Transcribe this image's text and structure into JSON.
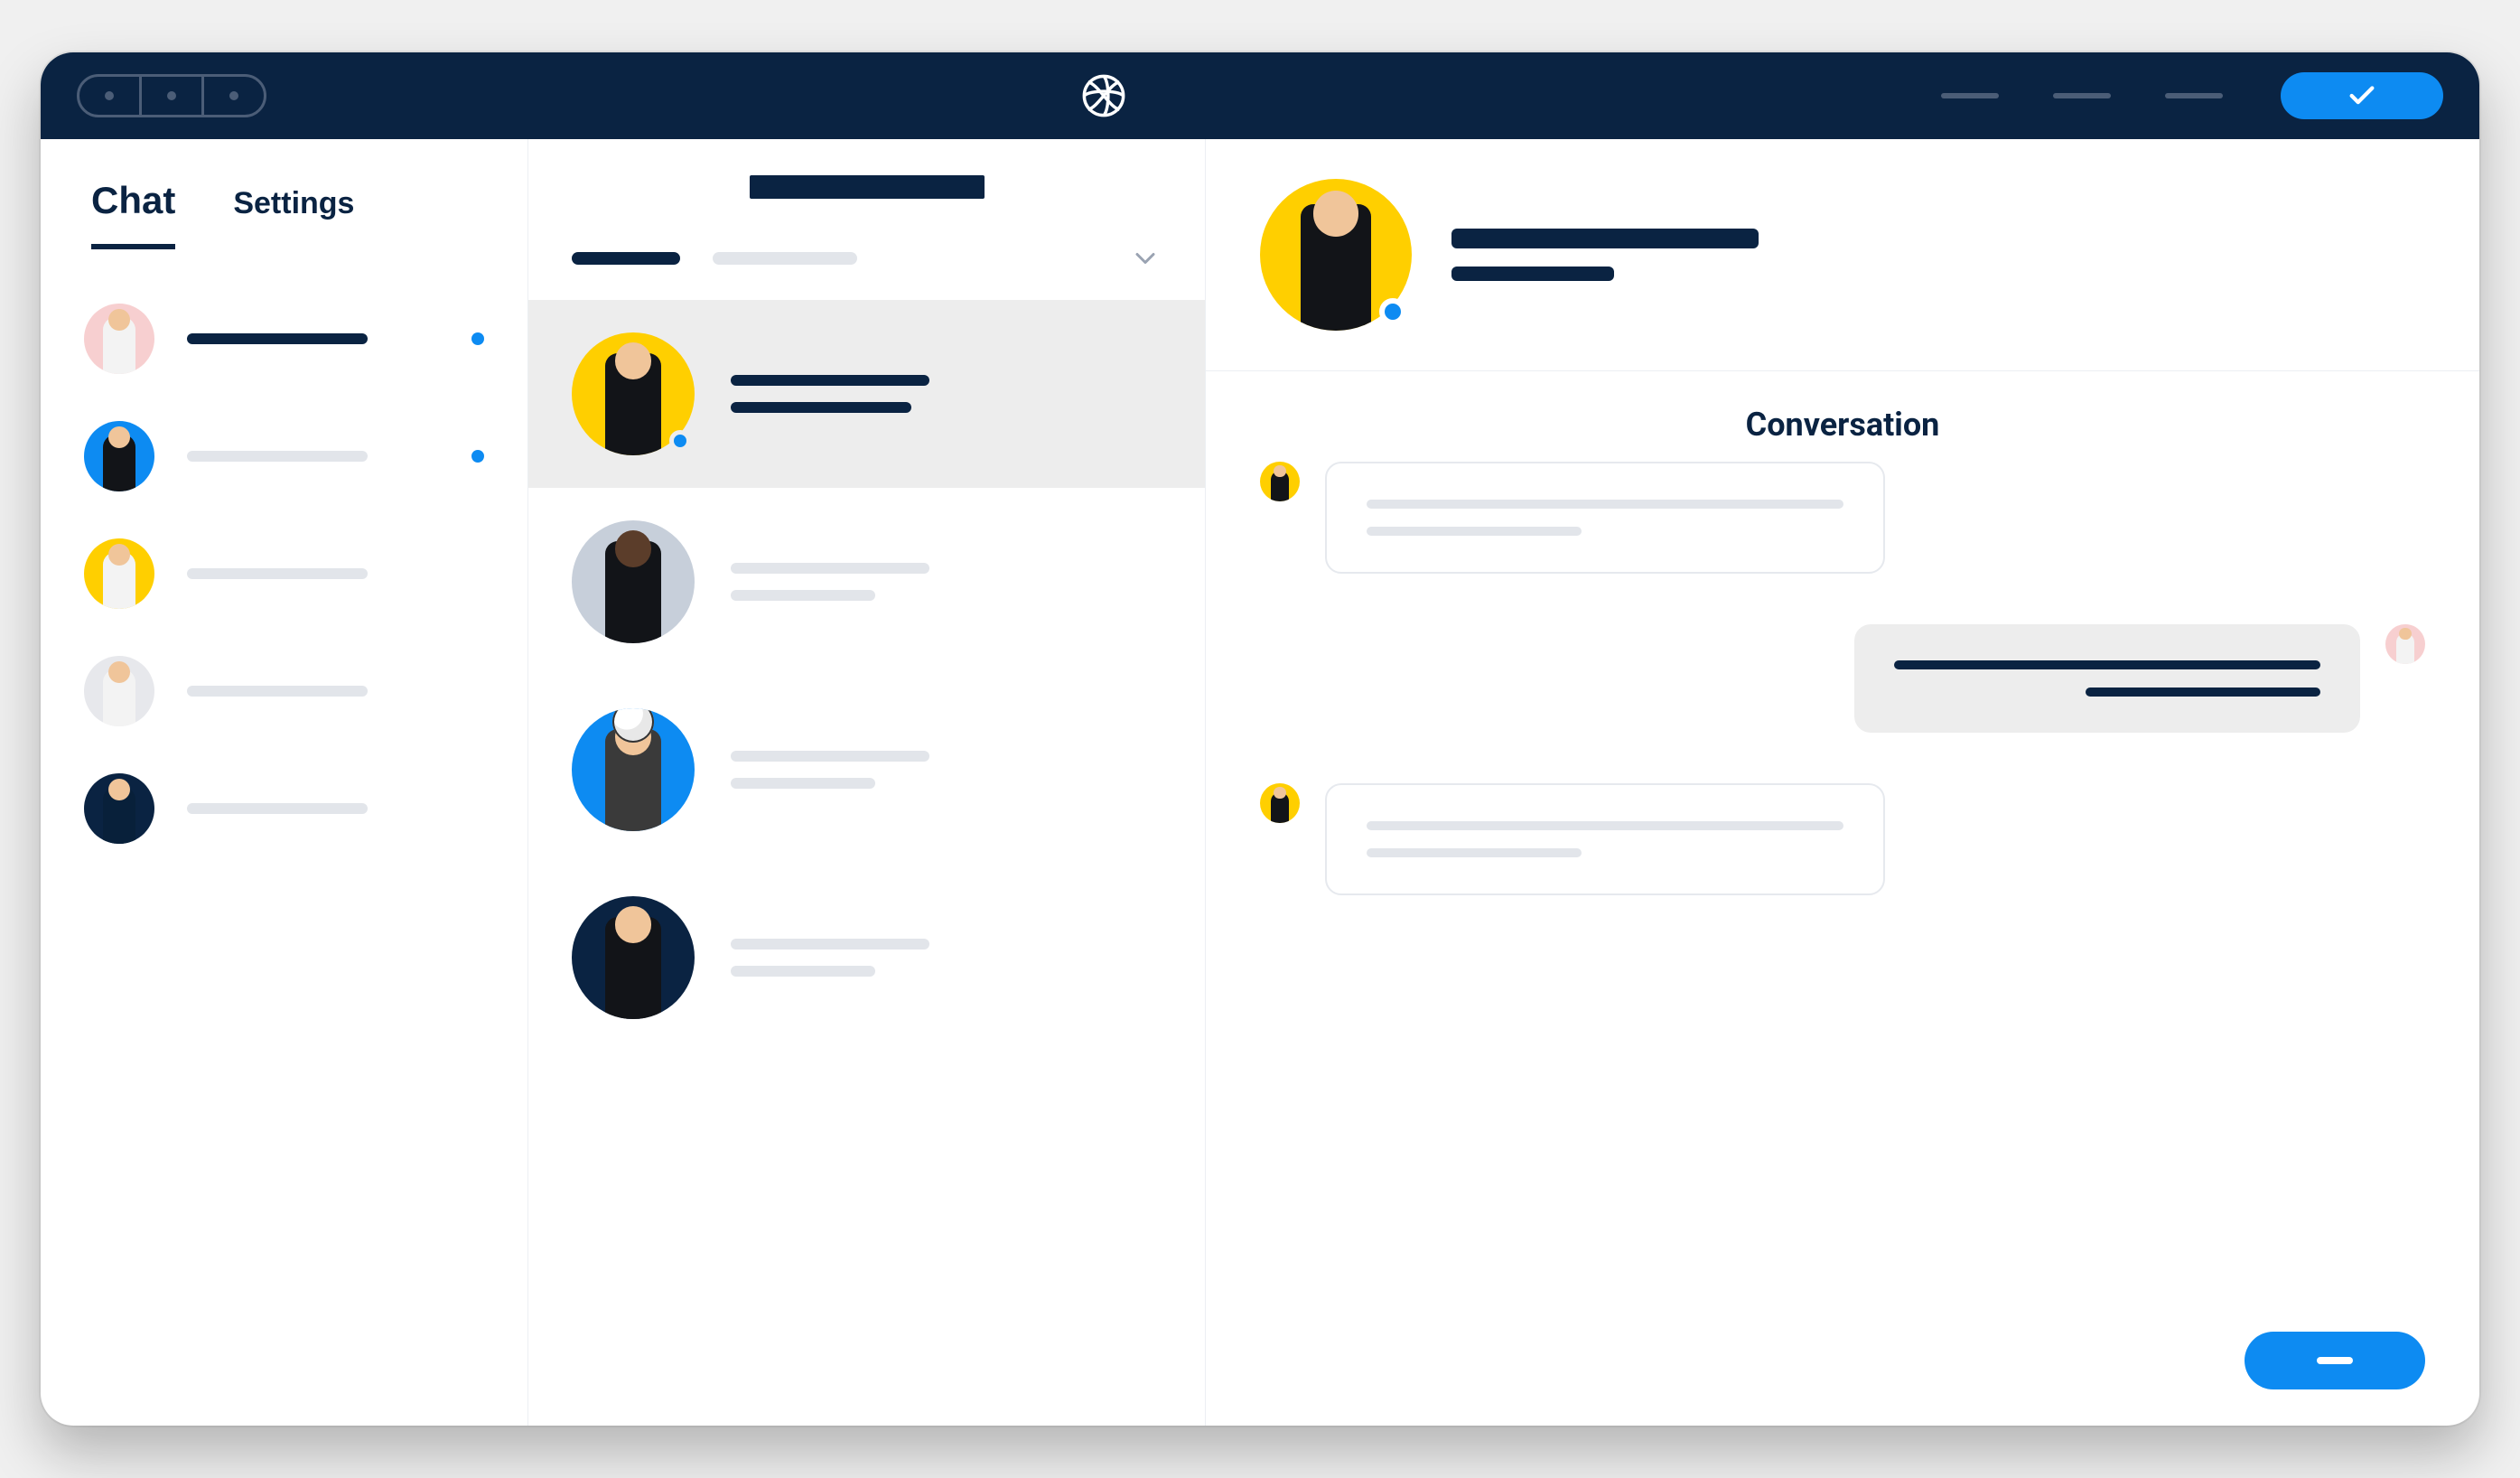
{
  "colors": {
    "navy": "#0a2342",
    "accent": "#0d8bf2",
    "yellow": "#ffcf00",
    "pink": "#f7cfd0",
    "muted": "#e2e5ea"
  },
  "topbar": {
    "window_dots": 3,
    "menu_placeholders": 3,
    "check_button_label": "✓"
  },
  "sidebar": {
    "tabs": [
      {
        "id": "chat",
        "label": "Chat",
        "active": true
      },
      {
        "id": "settings",
        "label": "Settings",
        "active": false
      }
    ],
    "contacts": [
      {
        "avatar_bg": "pink",
        "name_redacted": true,
        "unread": true
      },
      {
        "avatar_bg": "blue",
        "name_redacted": false,
        "unread": true
      },
      {
        "avatar_bg": "yellow",
        "name_redacted": false,
        "unread": false
      },
      {
        "avatar_bg": "grey",
        "name_redacted": false,
        "unread": false
      },
      {
        "avatar_bg": "navy",
        "name_redacted": false,
        "unread": false
      }
    ]
  },
  "threads": {
    "title_redacted": true,
    "filters": [
      {
        "redacted": true,
        "emphasis": true
      },
      {
        "redacted": true,
        "emphasis": false
      }
    ],
    "dropdown_icon": "chevron-down",
    "items": [
      {
        "avatar_bg": "yellow",
        "presence": true,
        "active": true,
        "line1_redacted": true,
        "line2_redacted": true
      },
      {
        "avatar_bg": "bluegrey",
        "presence": false,
        "active": false,
        "line1_redacted": false,
        "line2_redacted": false
      },
      {
        "avatar_bg": "blue",
        "presence": false,
        "active": false,
        "line1_redacted": false,
        "line2_redacted": false,
        "has_ball": true
      },
      {
        "avatar_bg": "navy",
        "presence": false,
        "active": false,
        "line1_redacted": false,
        "line2_redacted": false
      }
    ]
  },
  "conversation": {
    "header": {
      "avatar_bg": "yellow",
      "presence": true,
      "name_redacted": true,
      "sub_redacted": true
    },
    "section_title": "Conversation",
    "messages": [
      {
        "direction": "in",
        "avatar_bg": "yellow",
        "lines": [
          "full",
          "half"
        ]
      },
      {
        "direction": "out",
        "avatar_bg": "pink",
        "lines": [
          "full",
          "half"
        ]
      },
      {
        "direction": "in",
        "avatar_bg": "yellow",
        "lines": [
          "full",
          "half"
        ]
      }
    ],
    "send_button_label": "—"
  }
}
